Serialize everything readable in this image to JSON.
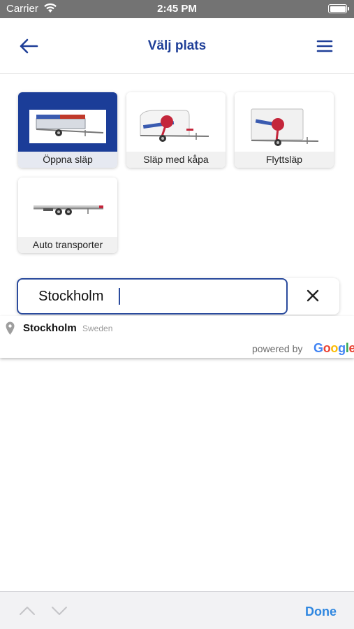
{
  "status_bar": {
    "carrier": "Carrier",
    "time": "2:45 PM"
  },
  "nav": {
    "title": "Välj plats",
    "back_icon": "arrow-left-icon",
    "menu_icon": "hamburger-menu-icon"
  },
  "trailer_types": [
    {
      "label": "Öppna släp",
      "selected": true
    },
    {
      "label": "Släp med kåpa",
      "selected": false
    },
    {
      "label": "Flyttsläp",
      "selected": false
    },
    {
      "label": "Auto transporter",
      "selected": false
    }
  ],
  "search": {
    "value": "Stockholm",
    "clear_icon": "close-icon"
  },
  "suggestions": [
    {
      "main": "Stockholm",
      "secondary": "Sweden"
    }
  ],
  "attribution": {
    "powered_by": "powered by",
    "brand": "Google"
  },
  "keyboard_accessory": {
    "done_label": "Done"
  },
  "colors": {
    "brand_blue": "#1f3f98",
    "done_blue": "#2f87e0",
    "status_bar": "#737373"
  }
}
